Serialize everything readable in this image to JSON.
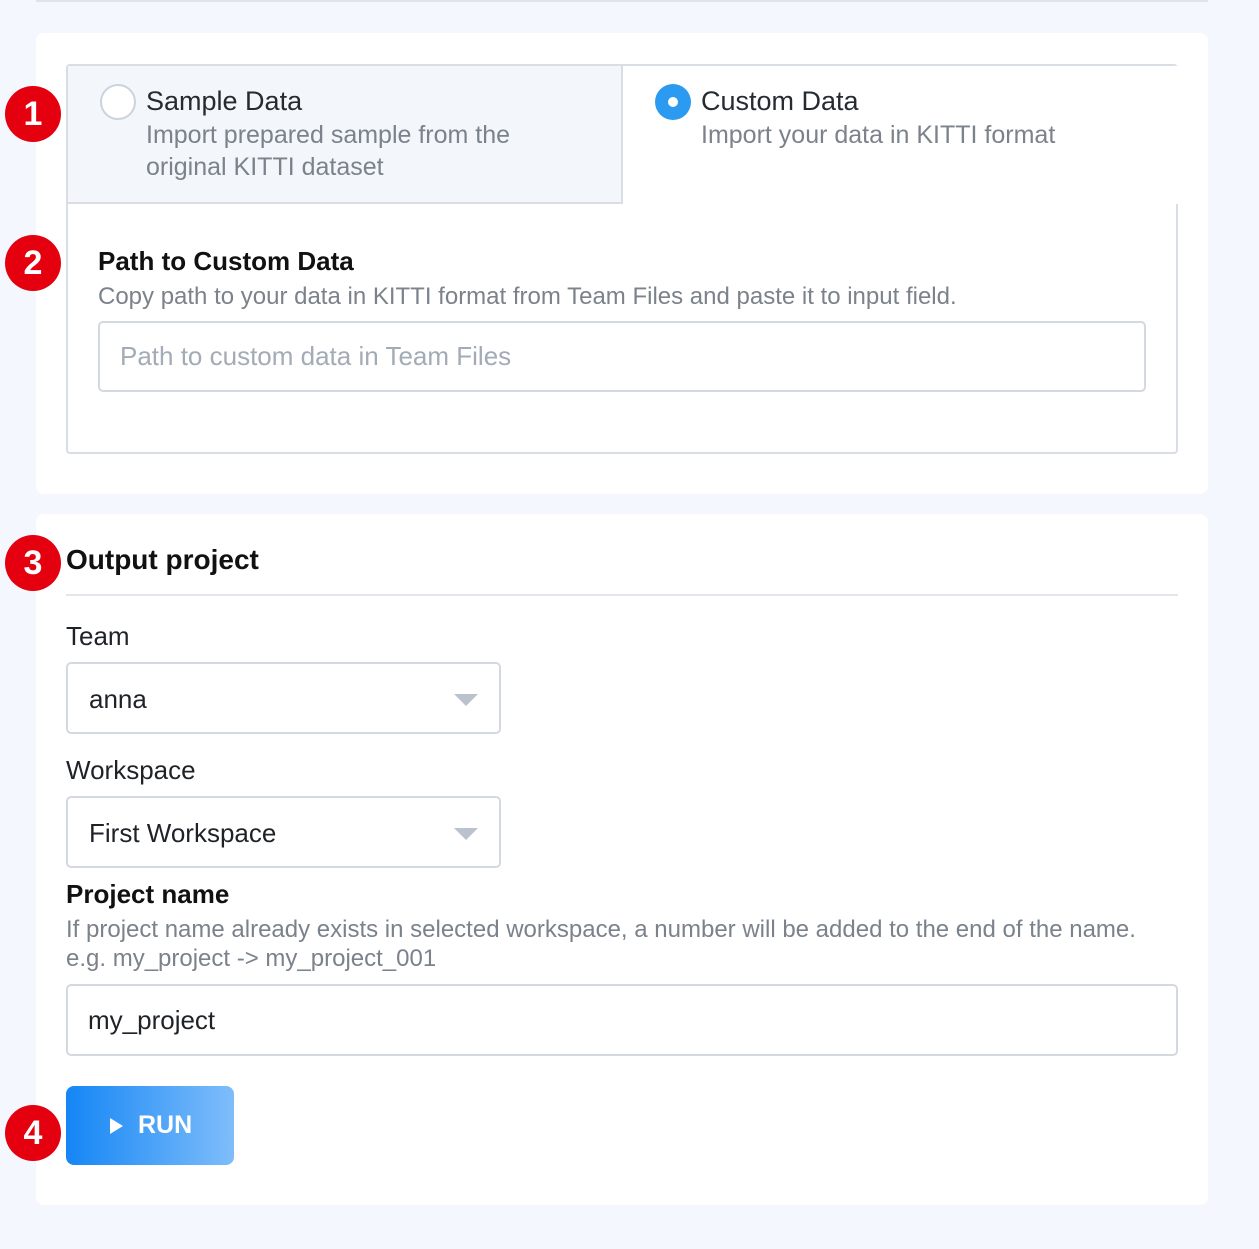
{
  "source": {
    "tabs": [
      {
        "title": "Sample Data",
        "description": "Import prepared sample from the original KITTI dataset",
        "selected": false
      },
      {
        "title": "Custom Data",
        "description": "Import your data in KITTI format",
        "selected": true
      }
    ],
    "custom_path": {
      "title": "Path to Custom Data",
      "help": "Copy path to your data in KITTI format from Team Files and paste it to input field.",
      "placeholder": "Path to custom data in Team Files",
      "value": ""
    }
  },
  "output": {
    "title": "Output project",
    "team": {
      "label": "Team",
      "value": "anna"
    },
    "workspace": {
      "label": "Workspace",
      "value": "First Workspace"
    },
    "project_name": {
      "label": "Project name",
      "help": "If project name already exists in selected workspace, a number will be added to the end of the name. e.g. my_project -> my_project_001",
      "value": "my_project"
    },
    "run_label": "RUN"
  },
  "markers": [
    "1",
    "2",
    "3",
    "4"
  ],
  "colors": {
    "accent": "#2a9bf0",
    "marker": "#e4000f",
    "run_gradient_start": "#1486f5",
    "run_gradient_end": "#7fbdfa"
  }
}
